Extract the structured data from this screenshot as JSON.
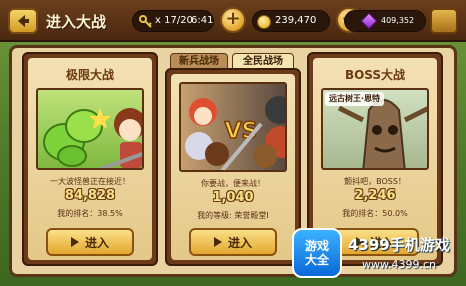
{
  "header": {
    "title": "进入大战",
    "keys": "x 17/20",
    "timer": "6:41",
    "coins": "239,470",
    "gems": "409,352"
  },
  "tabs": {
    "newbie": "新兵战场",
    "all": "全民战场"
  },
  "cards": [
    {
      "title": "极限大战",
      "desc": "一大波怪兽正在接近！",
      "score": "84,828",
      "rank": "我的排名：38.5%",
      "button": "进入"
    },
    {
      "title": "",
      "desc": "你要战，便来战！",
      "score": "1,040",
      "rank": "我的等级: 荣誉殿堂Ⅰ",
      "button": "进入"
    },
    {
      "title": "BOSS大战",
      "boss_name": "远古树王·恩特",
      "desc": "颤抖吧，BOSS！",
      "score": "2,246",
      "rank": "我的排名：50.0%",
      "button": "进入"
    }
  ],
  "watermark": {
    "logo_line1": "游戏",
    "logo_line2": "大全",
    "title": "4399手机游戏",
    "url": "www.4399.cn"
  },
  "icons": {
    "back": "back-arrow-icon",
    "key": "key-icon",
    "plus": "plus-icon",
    "coin": "coin-icon",
    "gem": "gem-icon",
    "play": "play-icon"
  },
  "colors": {
    "accent": "#e3a72e",
    "panel": "#f3e0b4",
    "wood": "#6b3a18"
  }
}
